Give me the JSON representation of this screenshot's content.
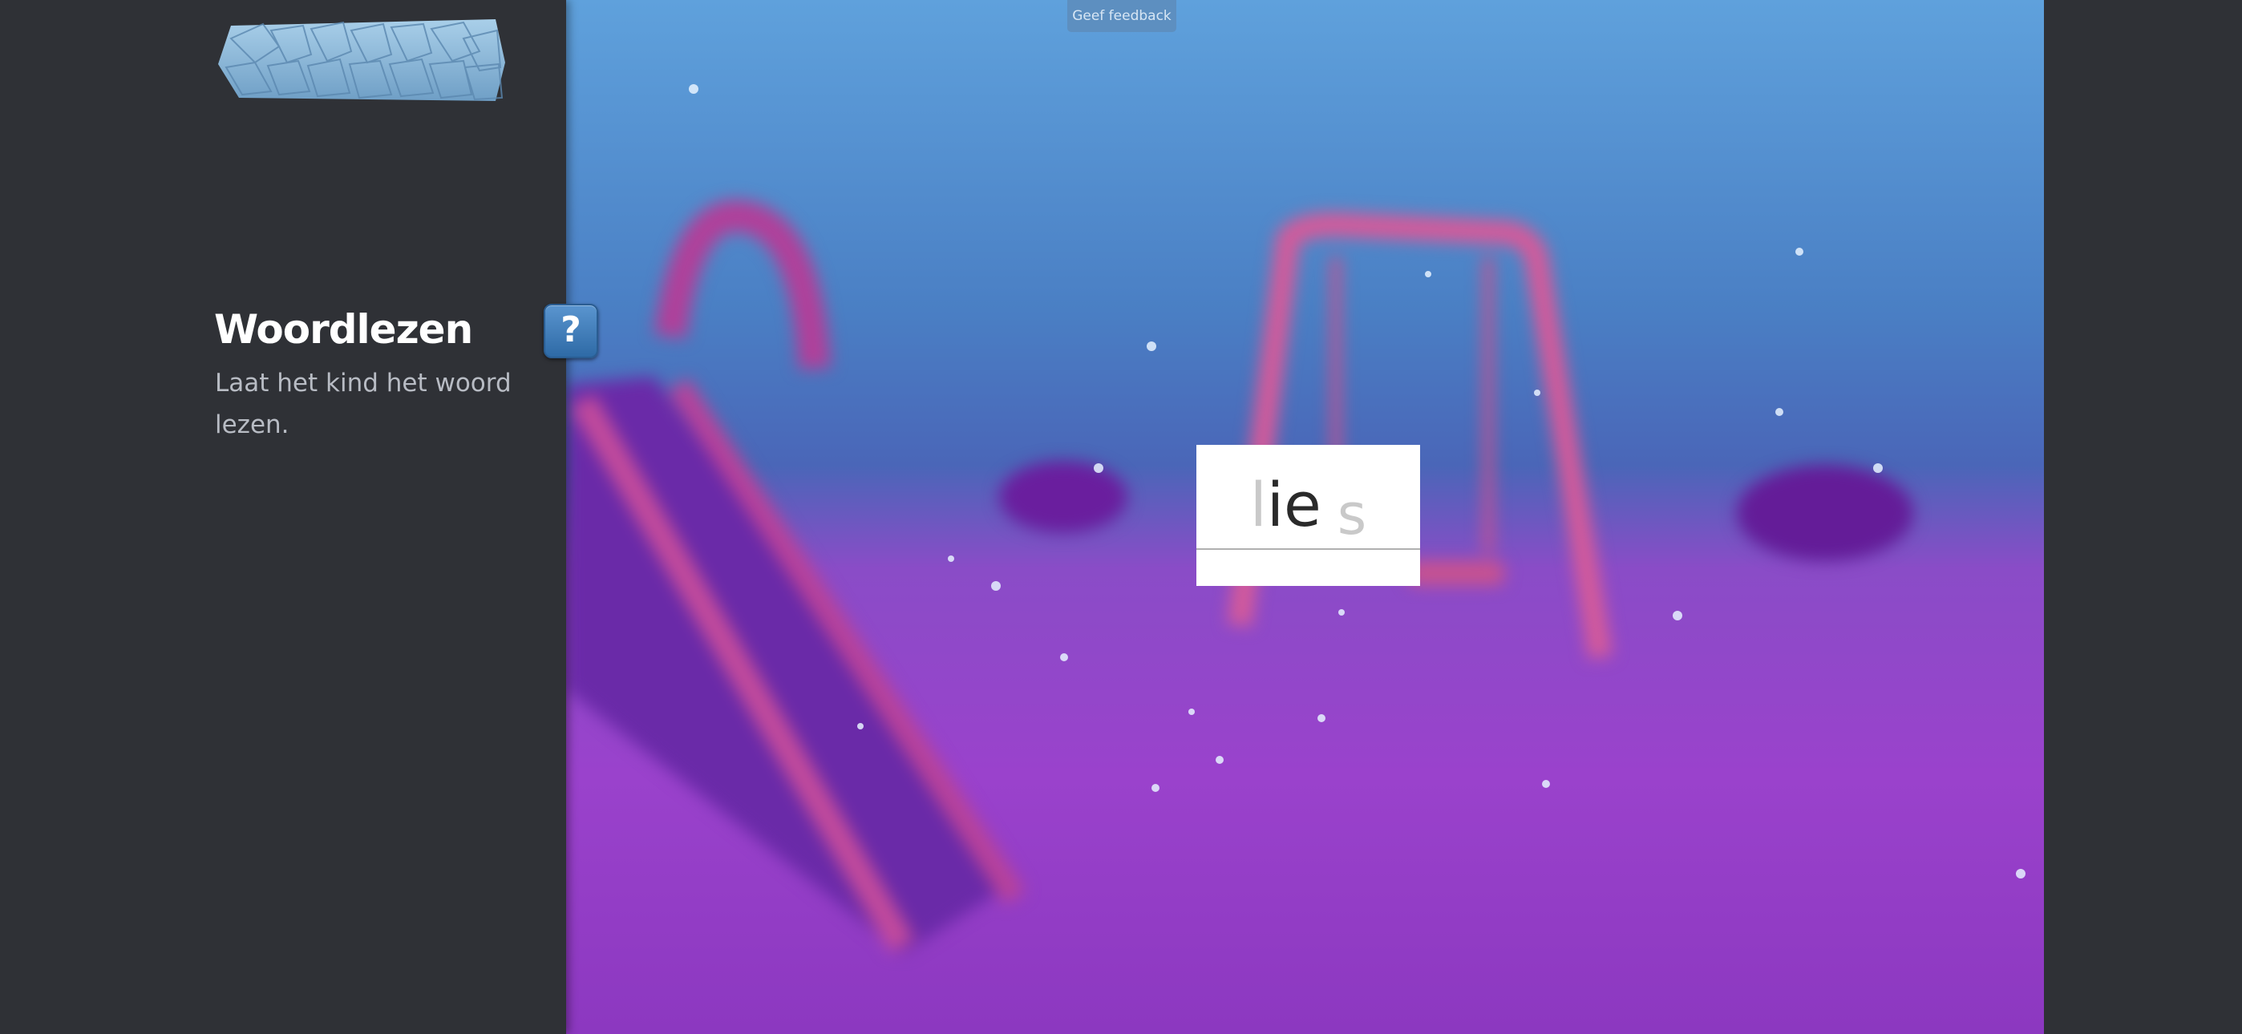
{
  "header": {
    "feedback_label": "Geef feedback"
  },
  "sidebar": {
    "title": "Woordlezen",
    "instruction": "Laat het kind het woord lezen.",
    "help_label": "?"
  },
  "exercise": {
    "letters": [
      {
        "text": "l",
        "state": "faded"
      },
      {
        "text": "ie",
        "state": "active"
      },
      {
        "text": "s",
        "state": "faded"
      }
    ]
  },
  "colors": {
    "sidebar_bg": "#2f3136",
    "help_button": "#3e7dbd",
    "feedback_button": "#5d8fc0"
  }
}
